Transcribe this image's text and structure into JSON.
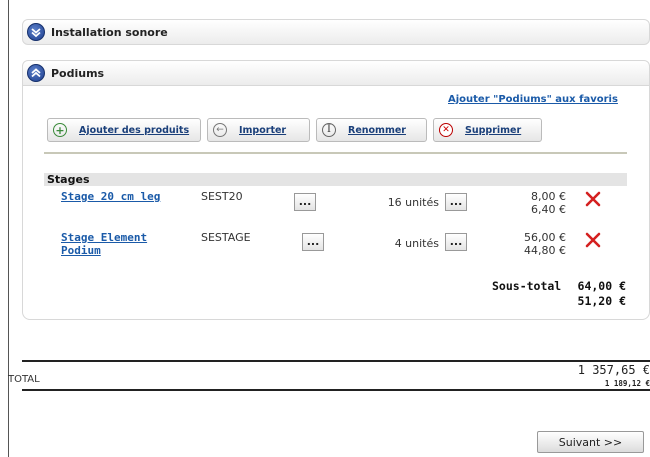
{
  "sections": {
    "installation": {
      "title": "Installation sonore"
    },
    "podiums": {
      "title": "Podiums",
      "favorite_link": "Ajouter \"Podiums\" aux favoris"
    }
  },
  "toolbar": {
    "add_label": "Ajouter des produits",
    "import_label": "Importer",
    "rename_label": "Renommer",
    "delete_label": "Supprimer"
  },
  "group": {
    "title": "Stages"
  },
  "products": [
    {
      "name_line1": "Stage 20 cm leg",
      "name_line2": "",
      "ref": "SEST20",
      "qty": "16 unités",
      "price_line1": "8,00 €",
      "price_line2": "6,40 €"
    },
    {
      "name_line1": "Stage Element",
      "name_line2": "Podium",
      "ref": "SESTAGE",
      "qty": "4 unités",
      "price_line1": "56,00 €",
      "price_line2": "44,80 €"
    }
  ],
  "dots_label": "...",
  "subtotal": {
    "label": "Sous-total",
    "value1": "64,00 €",
    "value2": "51,20 €"
  },
  "total": {
    "label": "TOTAL",
    "value1": "1 357,65 €",
    "value2": "1 189,12 €"
  },
  "next_button": "Suivant >>",
  "colors": {
    "link": "#1a5aa8",
    "header_icon": "#1e3f8f",
    "delete_red": "#d42020"
  }
}
